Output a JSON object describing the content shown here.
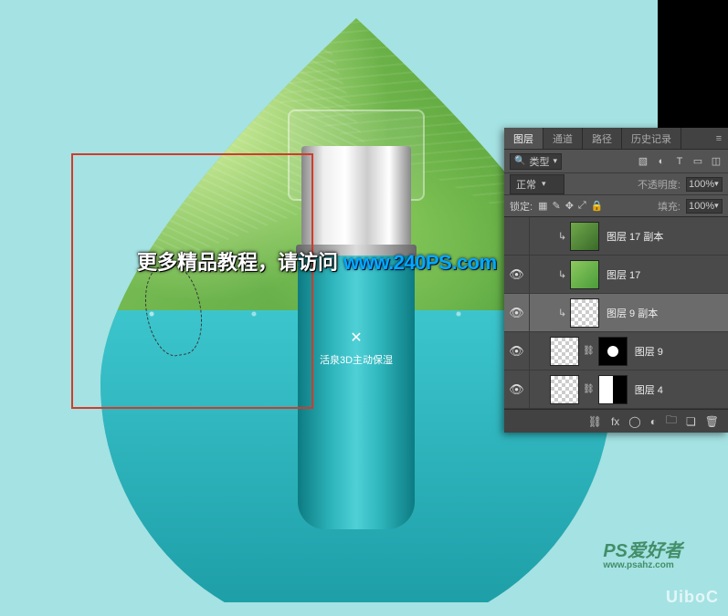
{
  "canvas": {
    "bottle_brand_line": "活泉3D主动保湿",
    "promo_prefix": "更多精品教程，请访问",
    "promo_url": "www.240PS.com",
    "watermark1": "PS爱好者",
    "watermark1_sub": "www.psahz.com",
    "watermark2": "UiboC"
  },
  "panel": {
    "tabs": {
      "layers": "图层",
      "channels": "通道",
      "paths": "路径",
      "history": "历史记录"
    },
    "filter": {
      "kind_label": "类型"
    },
    "blend": {
      "mode": "正常",
      "opacity_label": "不透明度:",
      "opacity_value": "100%"
    },
    "lock": {
      "label": "锁定:",
      "fill_label": "填充:",
      "fill_value": "100%"
    },
    "layers": [
      {
        "name": "图层 17 副本",
        "visible": false,
        "selected": false,
        "indent": 2,
        "thumbs": [
          "green"
        ],
        "clip": true
      },
      {
        "name": "图层 17",
        "visible": true,
        "selected": false,
        "indent": 2,
        "thumbs": [
          "green2"
        ],
        "clip": true
      },
      {
        "name": "图层 9 副本",
        "visible": true,
        "selected": true,
        "indent": 2,
        "thumbs": [
          "transparent"
        ],
        "clip": true
      },
      {
        "name": "图层 9",
        "visible": true,
        "selected": false,
        "indent": 1,
        "thumbs": [
          "transparent",
          "mask2"
        ],
        "clip": false
      },
      {
        "name": "图层 4",
        "visible": true,
        "selected": false,
        "indent": 1,
        "thumbs": [
          "transparent",
          "mask"
        ],
        "clip": false
      }
    ]
  }
}
